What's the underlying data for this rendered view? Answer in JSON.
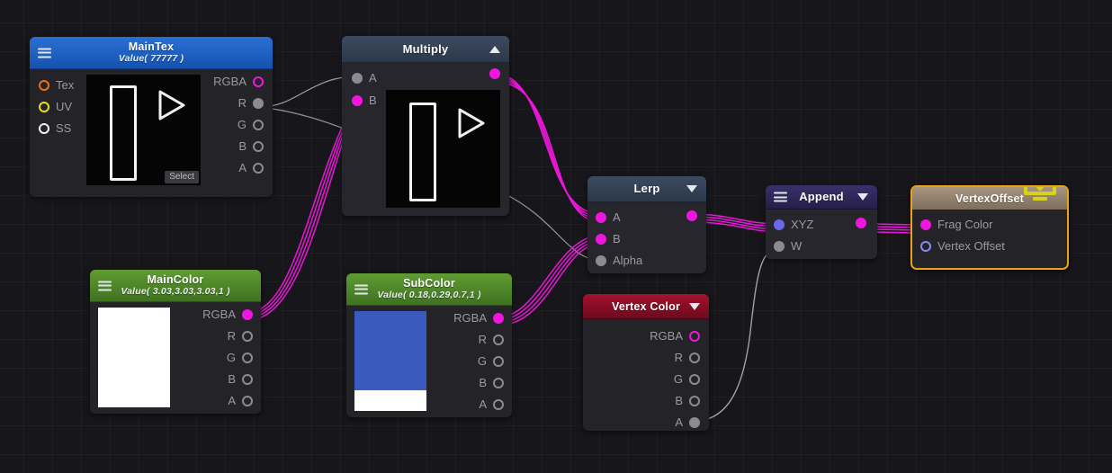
{
  "canvas": {
    "background_color": "#17171b",
    "grid_color": "#2a2a30",
    "wire_color_rgba": "#ef16e0",
    "wire_color_scalar": "#b9b9be"
  },
  "nodes": {
    "maintex": {
      "title": "MainTex",
      "subtitle": "Value( 77777 )",
      "header_color": "#2b6fd4",
      "menu_icon": "hamburger-icon",
      "select_button": "Select",
      "inputs": [
        {
          "label": "Tex",
          "dot": "orange-ring"
        },
        {
          "label": "UV",
          "dot": "yellow-ring"
        },
        {
          "label": "SS",
          "dot": "white-ring"
        }
      ],
      "outputs": [
        {
          "label": "RGBA",
          "dot": "mag-ring"
        },
        {
          "label": "R",
          "dot": "fill"
        },
        {
          "label": "G",
          "dot": "ring"
        },
        {
          "label": "B",
          "dot": "ring"
        },
        {
          "label": "A",
          "dot": "ring"
        }
      ]
    },
    "multiply": {
      "title": "Multiply",
      "header_color": "#3b4b60",
      "collapse_icon": "chevron-up-icon",
      "inputs": [
        {
          "label": "A",
          "dot": "fill"
        },
        {
          "label": "B",
          "dot": "mag-fill"
        }
      ],
      "outputs": [
        {
          "label": "",
          "dot": "mag-fill"
        }
      ]
    },
    "lerp": {
      "title": "Lerp",
      "header_color": "#3b4b60",
      "collapse_icon": "chevron-down-icon",
      "inputs": [
        {
          "label": "A",
          "dot": "mag-fill"
        },
        {
          "label": "B",
          "dot": "mag-fill"
        },
        {
          "label": "Alpha",
          "dot": "fill"
        }
      ],
      "outputs": [
        {
          "label": "",
          "dot": "mag-fill"
        }
      ]
    },
    "append": {
      "title": "Append",
      "header_color": "#393169",
      "menu_icon": "hamburger-icon",
      "collapse_icon": "chevron-down-icon",
      "inputs": [
        {
          "label": "XYZ",
          "dot": "blue-fill"
        },
        {
          "label": "W",
          "dot": "fill"
        }
      ],
      "outputs": [
        {
          "label": "",
          "dot": "mag-fill"
        }
      ]
    },
    "vertexoffset": {
      "title": "VertexOffset",
      "header_color": "#a89580",
      "border_color": "#e8a317",
      "icon": "monitor-download-icon",
      "inputs": [
        {
          "label": "Frag Color",
          "dot": "mag-fill"
        },
        {
          "label": "Vertex Offset",
          "dot": "blue-ring"
        }
      ]
    },
    "maincolor": {
      "title": "MainColor",
      "subtitle": "Value( 3.03,3.03,3.03,1 )",
      "header_color": "#5f9c32",
      "menu_icon": "hamburger-icon",
      "swatch_color": "#ffffff",
      "swatch_alpha_color": "#ffffff",
      "outputs": [
        {
          "label": "RGBA",
          "dot": "mag-fill"
        },
        {
          "label": "R",
          "dot": "ring"
        },
        {
          "label": "G",
          "dot": "ring"
        },
        {
          "label": "B",
          "dot": "ring"
        },
        {
          "label": "A",
          "dot": "ring"
        }
      ]
    },
    "subcolor": {
      "title": "SubColor",
      "subtitle": "Value( 0.18,0.29,0.7,1 )",
      "header_color": "#5f9c32",
      "menu_icon": "hamburger-icon",
      "swatch_color": "#3a5ac0",
      "swatch_alpha_color": "#ffffff",
      "outputs": [
        {
          "label": "RGBA",
          "dot": "mag-fill"
        },
        {
          "label": "R",
          "dot": "ring"
        },
        {
          "label": "G",
          "dot": "ring"
        },
        {
          "label": "B",
          "dot": "ring"
        },
        {
          "label": "A",
          "dot": "ring"
        }
      ]
    },
    "vertexcolor": {
      "title": "Vertex Color",
      "header_color": "#a4122e",
      "collapse_icon": "chevron-down-icon",
      "outputs": [
        {
          "label": "RGBA",
          "dot": "mag-ring"
        },
        {
          "label": "R",
          "dot": "ring"
        },
        {
          "label": "G",
          "dot": "ring"
        },
        {
          "label": "B",
          "dot": "ring"
        },
        {
          "label": "A",
          "dot": "fill"
        }
      ]
    }
  }
}
